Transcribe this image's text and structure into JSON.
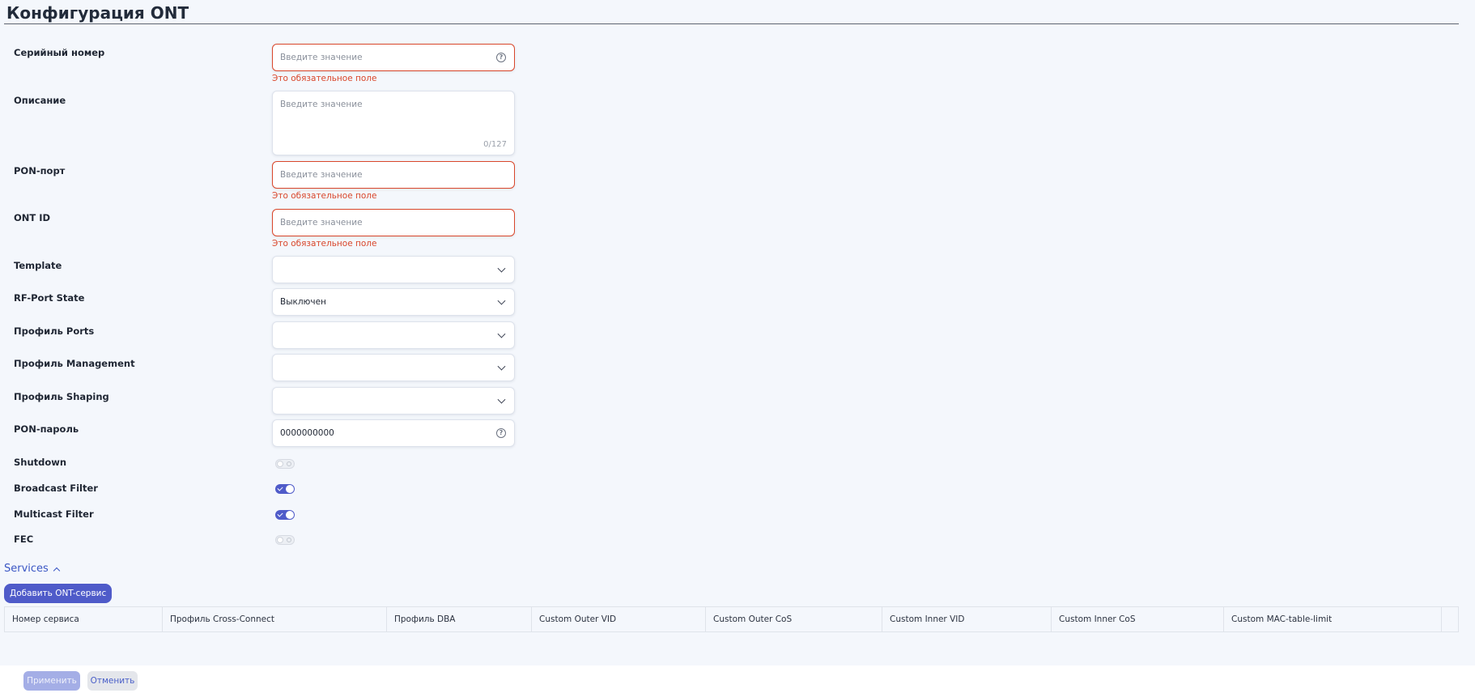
{
  "page": {
    "title": "Конфигурация ONT"
  },
  "form": {
    "serial": {
      "label": "Серийный номер",
      "placeholder": "Введите значение",
      "error": "Это обязательное поле"
    },
    "description": {
      "label": "Описание",
      "placeholder": "Введите значение",
      "counter": "0/127"
    },
    "pon_port": {
      "label": "PON-порт",
      "placeholder": "Введите значение",
      "error": "Это обязательное поле"
    },
    "ont_id": {
      "label": "ONT ID",
      "placeholder": "Введите значение",
      "error": "Это обязательное поле"
    },
    "template": {
      "label": "Template",
      "value": ""
    },
    "rf_port_state": {
      "label": "RF-Port State",
      "value": "Выключен"
    },
    "profile_ports": {
      "label": "Профиль Ports",
      "value": ""
    },
    "profile_management": {
      "label": "Профиль Management",
      "value": ""
    },
    "profile_shaping": {
      "label": "Профиль Shaping",
      "value": ""
    },
    "pon_password": {
      "label": "PON-пароль",
      "value": "0000000000"
    },
    "shutdown": {
      "label": "Shutdown",
      "checked": false
    },
    "broadcast_filter": {
      "label": "Broadcast Filter",
      "checked": true
    },
    "multicast_filter": {
      "label": "Multicast Filter",
      "checked": true
    },
    "fec": {
      "label": "FEC",
      "checked": false
    }
  },
  "services": {
    "title": "Services",
    "add_button": "Добавить ONT-сервис",
    "columns": [
      "Номер сервиса",
      "Профиль Cross-Connect",
      "Профиль DBA",
      "Custom Outer VID",
      "Custom Outer CoS",
      "Custom Inner VID",
      "Custom Inner CoS",
      "Custom MAC-table-limit",
      ""
    ]
  },
  "footer": {
    "apply": "Применить",
    "cancel": "Отменить"
  },
  "colors": {
    "accent": "#4f5bc9",
    "error": "#d9472b",
    "link": "#3a56c4"
  }
}
